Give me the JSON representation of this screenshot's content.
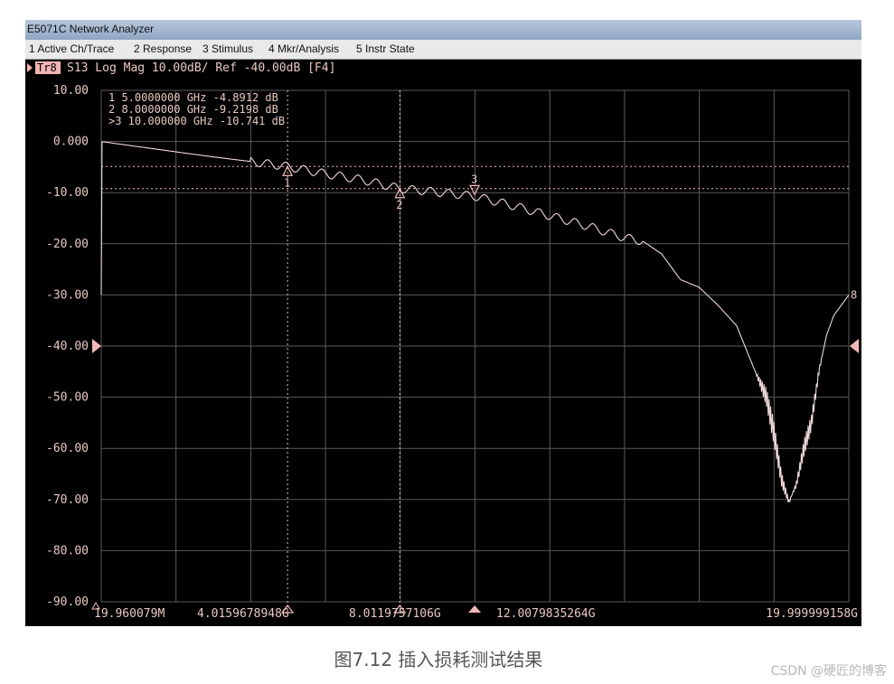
{
  "window": {
    "title": "E5071C Network Analyzer"
  },
  "menu": [
    {
      "label": "1 Active Ch/Trace"
    },
    {
      "label": "2 Response"
    },
    {
      "label": "3 Stimulus"
    },
    {
      "label": "4 Mkr/Analysis"
    },
    {
      "label": "5 Instr State"
    }
  ],
  "caption": "图7.12 插入损耗测试结果",
  "watermark": "CSDN @硬匠的博客",
  "colors": {
    "background": "#000000",
    "grid": "#5a5a5a",
    "trace": "#f0d8d8",
    "label": "#e8c8c0",
    "marker": "#f2b8b8",
    "trace_badge": "#f4b4b4"
  },
  "chart_data": {
    "type": "line",
    "trace_badge": "Tr8",
    "trace_header": "S13 Log Mag 10.00dB/ Ref -40.00dB [F4]",
    "trace_end_label": "8",
    "ylim": [
      -90,
      10
    ],
    "y_ticks": [
      "10.00",
      "0.000",
      "-10.00",
      "-20.00",
      "-30.00",
      "-40.00",
      "-50.00",
      "-60.00",
      "-70.00",
      "-80.00",
      "-90.00"
    ],
    "x_range_hz": [
      19960079,
      19999999158
    ],
    "x_tick_labels": [
      "19.960079M",
      "4.01596789​48G",
      "8.0119757106G",
      "12.0079835264G",
      "19.999999158G"
    ],
    "reference_level": -40,
    "markers": [
      {
        "id": "1",
        "freq_ghz": 5.0,
        "value_db": -4.8912,
        "readout": "1   5.0000000 GHz -4.8912 dB",
        "style": "up"
      },
      {
        "id": "2",
        "freq_ghz": 8.0,
        "value_db": -9.2198,
        "readout": "2   8.0000000 GHz -9.2198 dB",
        "style": "up"
      },
      {
        "id": "3",
        "freq_ghz": 10.0,
        "value_db": -10.741,
        "readout": ">3  10.000000 GHz -10.741 dB",
        "style": "down"
      }
    ],
    "series": [
      {
        "x_ghz": [
          0.02,
          1,
          2,
          3,
          4,
          5,
          6,
          7,
          8,
          9,
          10,
          11,
          12,
          13,
          14,
          14.5,
          15,
          15.5,
          16,
          16.5,
          17,
          17.5,
          17.8,
          18.0,
          18.2,
          18.4,
          18.6,
          18.8,
          19.0,
          19.2,
          19.4,
          19.6,
          19.8,
          20.0
        ],
        "y_db": [
          0,
          -1,
          -2,
          -3,
          -3.9,
          -4.9,
          -6.3,
          -7.5,
          -9.2,
          -9.9,
          -10.7,
          -12.5,
          -14.5,
          -16.5,
          -18.8,
          -19.5,
          -22,
          -27,
          -28.5,
          -32,
          -36,
          -45,
          -50,
          -57,
          -66,
          -70.5,
          -67,
          -60,
          -55,
          -45,
          -38,
          -34,
          -32,
          -30
        ]
      }
    ]
  }
}
